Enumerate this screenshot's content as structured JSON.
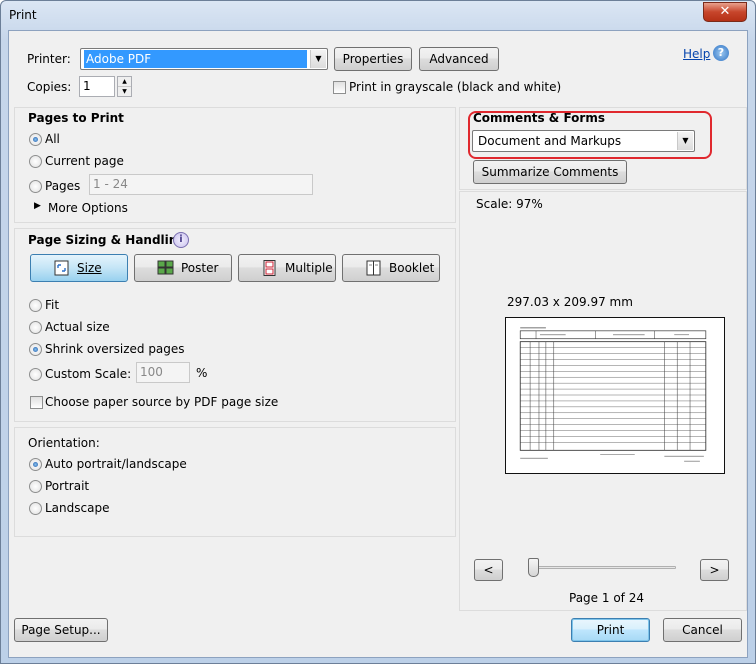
{
  "window": {
    "title": "Print",
    "close_glyph": "✕"
  },
  "top": {
    "printer_label": "Printer:",
    "printer_value": "Adobe PDF",
    "properties_button": "Properties",
    "advanced_button": "Advanced",
    "help_link": "Help",
    "copies_label": "Copies:",
    "copies_value": "1",
    "grayscale_label": "Print in grayscale (black and white)"
  },
  "pages_to_print": {
    "title": "Pages to Print",
    "options": [
      {
        "label": "All",
        "selected": true
      },
      {
        "label": "Current page",
        "selected": false
      },
      {
        "label": "Pages",
        "selected": false
      }
    ],
    "pages_range_value": "1 - 24",
    "more_options": "More Options"
  },
  "page_sizing": {
    "title": "Page Sizing & Handling",
    "buttons": [
      "Size",
      "Poster",
      "Multiple",
      "Booklet"
    ],
    "active_button": "Size",
    "options": [
      {
        "label": "Fit",
        "selected": false
      },
      {
        "label": "Actual size",
        "selected": false
      },
      {
        "label": "Shrink oversized pages",
        "selected": true
      },
      {
        "label": "Custom Scale:",
        "selected": false
      }
    ],
    "custom_scale_value": "100",
    "percent_symbol": "%",
    "paper_source_label": "Choose paper source by PDF page size"
  },
  "orientation": {
    "title": "Orientation:",
    "options": [
      {
        "label": "Auto portrait/landscape",
        "selected": true
      },
      {
        "label": "Portrait",
        "selected": false
      },
      {
        "label": "Landscape",
        "selected": false
      }
    ]
  },
  "comments_forms": {
    "title": "Comments & Forms",
    "value": "Document and Markups",
    "summarize_button": "Summarize Comments",
    "highlight_color": "#e0282e"
  },
  "preview": {
    "scale_text": "Scale:  97%",
    "dimensions": "297.03 x 209.97 mm",
    "prev_glyph": "<",
    "next_glyph": ">",
    "page_indicator": "Page 1 of 24",
    "slider_position": 0
  },
  "bottom": {
    "page_setup_button": "Page Setup...",
    "print_button": "Print",
    "cancel_button": "Cancel"
  }
}
